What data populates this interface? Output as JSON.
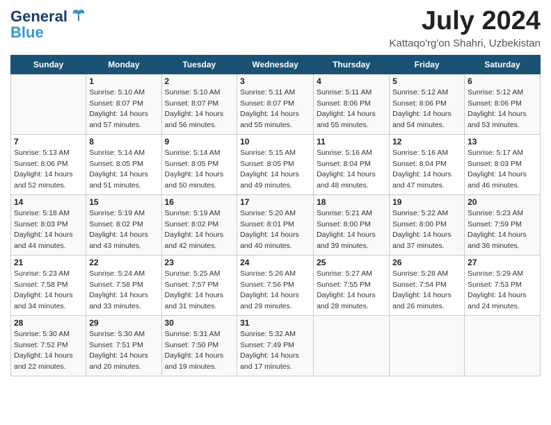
{
  "logo": {
    "line1": "General",
    "line2": "Blue"
  },
  "title": "July 2024",
  "subtitle": "Kattaqo'rg'on Shahri, Uzbekistan",
  "header_days": [
    "Sunday",
    "Monday",
    "Tuesday",
    "Wednesday",
    "Thursday",
    "Friday",
    "Saturday"
  ],
  "weeks": [
    [
      {
        "day": "",
        "sunrise": "",
        "sunset": "",
        "daylight": ""
      },
      {
        "day": "1",
        "sunrise": "Sunrise: 5:10 AM",
        "sunset": "Sunset: 8:07 PM",
        "daylight": "Daylight: 14 hours and 57 minutes."
      },
      {
        "day": "2",
        "sunrise": "Sunrise: 5:10 AM",
        "sunset": "Sunset: 8:07 PM",
        "daylight": "Daylight: 14 hours and 56 minutes."
      },
      {
        "day": "3",
        "sunrise": "Sunrise: 5:11 AM",
        "sunset": "Sunset: 8:07 PM",
        "daylight": "Daylight: 14 hours and 55 minutes."
      },
      {
        "day": "4",
        "sunrise": "Sunrise: 5:11 AM",
        "sunset": "Sunset: 8:06 PM",
        "daylight": "Daylight: 14 hours and 55 minutes."
      },
      {
        "day": "5",
        "sunrise": "Sunrise: 5:12 AM",
        "sunset": "Sunset: 8:06 PM",
        "daylight": "Daylight: 14 hours and 54 minutes."
      },
      {
        "day": "6",
        "sunrise": "Sunrise: 5:12 AM",
        "sunset": "Sunset: 8:06 PM",
        "daylight": "Daylight: 14 hours and 53 minutes."
      }
    ],
    [
      {
        "day": "7",
        "sunrise": "Sunrise: 5:13 AM",
        "sunset": "Sunset: 8:06 PM",
        "daylight": "Daylight: 14 hours and 52 minutes."
      },
      {
        "day": "8",
        "sunrise": "Sunrise: 5:14 AM",
        "sunset": "Sunset: 8:05 PM",
        "daylight": "Daylight: 14 hours and 51 minutes."
      },
      {
        "day": "9",
        "sunrise": "Sunrise: 5:14 AM",
        "sunset": "Sunset: 8:05 PM",
        "daylight": "Daylight: 14 hours and 50 minutes."
      },
      {
        "day": "10",
        "sunrise": "Sunrise: 5:15 AM",
        "sunset": "Sunset: 8:05 PM",
        "daylight": "Daylight: 14 hours and 49 minutes."
      },
      {
        "day": "11",
        "sunrise": "Sunrise: 5:16 AM",
        "sunset": "Sunset: 8:04 PM",
        "daylight": "Daylight: 14 hours and 48 minutes."
      },
      {
        "day": "12",
        "sunrise": "Sunrise: 5:16 AM",
        "sunset": "Sunset: 8:04 PM",
        "daylight": "Daylight: 14 hours and 47 minutes."
      },
      {
        "day": "13",
        "sunrise": "Sunrise: 5:17 AM",
        "sunset": "Sunset: 8:03 PM",
        "daylight": "Daylight: 14 hours and 46 minutes."
      }
    ],
    [
      {
        "day": "14",
        "sunrise": "Sunrise: 5:18 AM",
        "sunset": "Sunset: 8:03 PM",
        "daylight": "Daylight: 14 hours and 44 minutes."
      },
      {
        "day": "15",
        "sunrise": "Sunrise: 5:19 AM",
        "sunset": "Sunset: 8:02 PM",
        "daylight": "Daylight: 14 hours and 43 minutes."
      },
      {
        "day": "16",
        "sunrise": "Sunrise: 5:19 AM",
        "sunset": "Sunset: 8:02 PM",
        "daylight": "Daylight: 14 hours and 42 minutes."
      },
      {
        "day": "17",
        "sunrise": "Sunrise: 5:20 AM",
        "sunset": "Sunset: 8:01 PM",
        "daylight": "Daylight: 14 hours and 40 minutes."
      },
      {
        "day": "18",
        "sunrise": "Sunrise: 5:21 AM",
        "sunset": "Sunset: 8:00 PM",
        "daylight": "Daylight: 14 hours and 39 minutes."
      },
      {
        "day": "19",
        "sunrise": "Sunrise: 5:22 AM",
        "sunset": "Sunset: 8:00 PM",
        "daylight": "Daylight: 14 hours and 37 minutes."
      },
      {
        "day": "20",
        "sunrise": "Sunrise: 5:23 AM",
        "sunset": "Sunset: 7:59 PM",
        "daylight": "Daylight: 14 hours and 36 minutes."
      }
    ],
    [
      {
        "day": "21",
        "sunrise": "Sunrise: 5:23 AM",
        "sunset": "Sunset: 7:58 PM",
        "daylight": "Daylight: 14 hours and 34 minutes."
      },
      {
        "day": "22",
        "sunrise": "Sunrise: 5:24 AM",
        "sunset": "Sunset: 7:58 PM",
        "daylight": "Daylight: 14 hours and 33 minutes."
      },
      {
        "day": "23",
        "sunrise": "Sunrise: 5:25 AM",
        "sunset": "Sunset: 7:57 PM",
        "daylight": "Daylight: 14 hours and 31 minutes."
      },
      {
        "day": "24",
        "sunrise": "Sunrise: 5:26 AM",
        "sunset": "Sunset: 7:56 PM",
        "daylight": "Daylight: 14 hours and 29 minutes."
      },
      {
        "day": "25",
        "sunrise": "Sunrise: 5:27 AM",
        "sunset": "Sunset: 7:55 PM",
        "daylight": "Daylight: 14 hours and 28 minutes."
      },
      {
        "day": "26",
        "sunrise": "Sunrise: 5:28 AM",
        "sunset": "Sunset: 7:54 PM",
        "daylight": "Daylight: 14 hours and 26 minutes."
      },
      {
        "day": "27",
        "sunrise": "Sunrise: 5:29 AM",
        "sunset": "Sunset: 7:53 PM",
        "daylight": "Daylight: 14 hours and 24 minutes."
      }
    ],
    [
      {
        "day": "28",
        "sunrise": "Sunrise: 5:30 AM",
        "sunset": "Sunset: 7:52 PM",
        "daylight": "Daylight: 14 hours and 22 minutes."
      },
      {
        "day": "29",
        "sunrise": "Sunrise: 5:30 AM",
        "sunset": "Sunset: 7:51 PM",
        "daylight": "Daylight: 14 hours and 20 minutes."
      },
      {
        "day": "30",
        "sunrise": "Sunrise: 5:31 AM",
        "sunset": "Sunset: 7:50 PM",
        "daylight": "Daylight: 14 hours and 19 minutes."
      },
      {
        "day": "31",
        "sunrise": "Sunrise: 5:32 AM",
        "sunset": "Sunset: 7:49 PM",
        "daylight": "Daylight: 14 hours and 17 minutes."
      },
      {
        "day": "",
        "sunrise": "",
        "sunset": "",
        "daylight": ""
      },
      {
        "day": "",
        "sunrise": "",
        "sunset": "",
        "daylight": ""
      },
      {
        "day": "",
        "sunrise": "",
        "sunset": "",
        "daylight": ""
      }
    ]
  ]
}
